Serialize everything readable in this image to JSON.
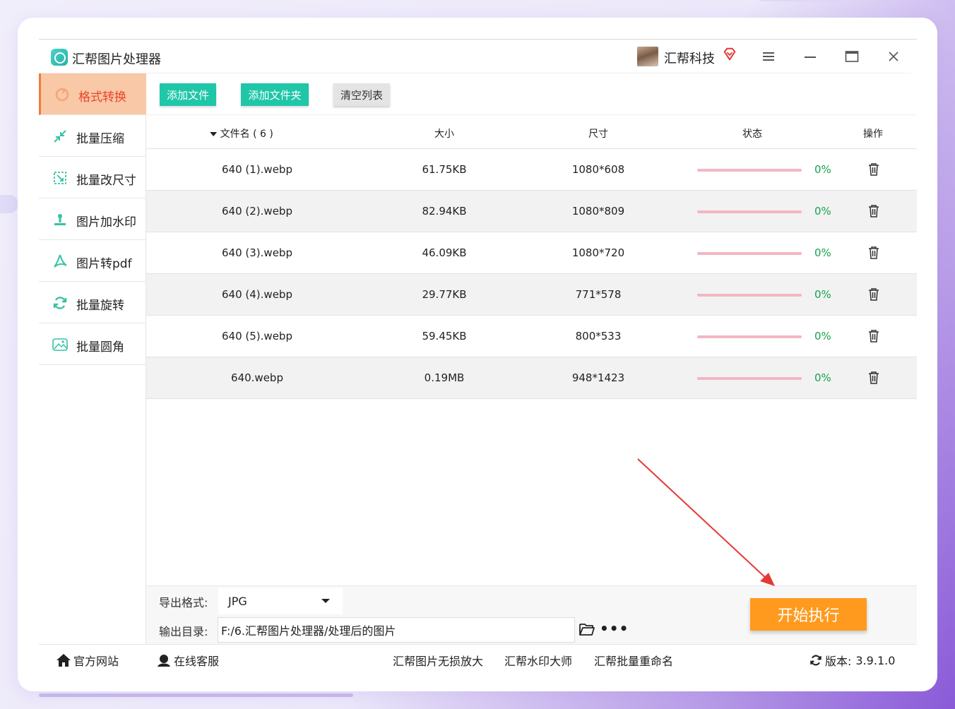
{
  "app": {
    "title": "汇帮图片处理器"
  },
  "user": {
    "name": "汇帮科技"
  },
  "window_controls": [
    "menu-icon",
    "minimize-icon",
    "maximize-icon",
    "close-icon"
  ],
  "sidebar": {
    "items": [
      {
        "label": "格式转换",
        "icon": "format-convert-icon",
        "active": true
      },
      {
        "label": "批量压缩",
        "icon": "compress-icon",
        "active": false
      },
      {
        "label": "批量改尺寸",
        "icon": "resize-icon",
        "active": false
      },
      {
        "label": "图片加水印",
        "icon": "watermark-icon",
        "active": false
      },
      {
        "label": "图片转pdf",
        "icon": "pdf-icon",
        "active": false
      },
      {
        "label": "批量旋转",
        "icon": "rotate-icon",
        "active": false
      },
      {
        "label": "批量圆角",
        "icon": "round-corner-icon",
        "active": false
      }
    ]
  },
  "toolbar": {
    "add_file": "添加文件",
    "add_folder": "添加文件夹",
    "clear_list": "清空列表"
  },
  "table": {
    "headers": {
      "filename": "文件名 ( 6 )",
      "size": "大小",
      "dimensions": "尺寸",
      "status": "状态",
      "action": "操作"
    },
    "rows": [
      {
        "name": "640 (1).webp",
        "size": "61.75KB",
        "dim": "1080*608",
        "progress": 0,
        "pct": "0%"
      },
      {
        "name": "640 (2).webp",
        "size": "82.94KB",
        "dim": "1080*809",
        "progress": 0,
        "pct": "0%"
      },
      {
        "name": "640 (3).webp",
        "size": "46.09KB",
        "dim": "1080*720",
        "progress": 0,
        "pct": "0%"
      },
      {
        "name": "640 (4).webp",
        "size": "29.77KB",
        "dim": "771*578",
        "progress": 0,
        "pct": "0%"
      },
      {
        "name": "640 (5).webp",
        "size": "59.45KB",
        "dim": "800*533",
        "progress": 0,
        "pct": "0%"
      },
      {
        "name": "640.webp",
        "size": "0.19MB",
        "dim": "948*1423",
        "progress": 0,
        "pct": "0%"
      }
    ]
  },
  "settings": {
    "format_label": "导出格式:",
    "format_value": "JPG",
    "output_label": "输出目录:",
    "output_value": "F:/6.汇帮图片处理器/处理后的图片",
    "start_button": "开始执行"
  },
  "footer": {
    "website": "官方网站",
    "support": "在线客服",
    "link1": "汇帮图片无损放大",
    "link2": "汇帮水印大师",
    "link3": "汇帮批量重命名",
    "version_label": "版本:",
    "version": "3.9.1.0"
  },
  "colors": {
    "accent_teal": "#1fc6a8",
    "active_bg": "#f9c8a6",
    "active_text": "#e8452c",
    "start_orange": "#ff9a1f",
    "progress_track": "#f3b6c3",
    "pct_green": "#16a34a",
    "annotation_arrow": "#e53935"
  }
}
